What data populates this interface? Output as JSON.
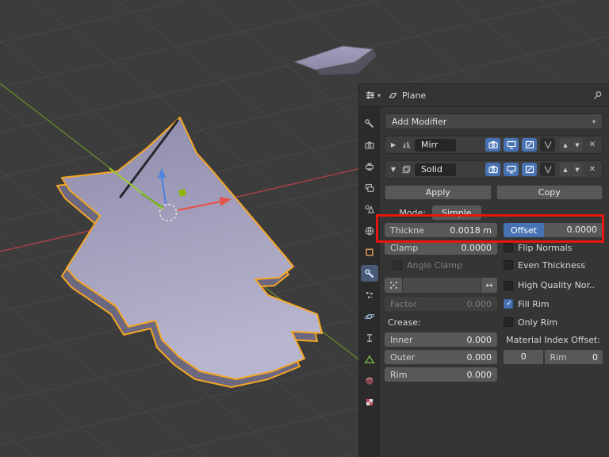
{
  "header": {
    "object_name": "Plane"
  },
  "tabs": {
    "items": [
      "tool",
      "render",
      "output",
      "view-layer",
      "scene",
      "world",
      "object",
      "modifiers",
      "particles",
      "physics",
      "constraints",
      "object-data",
      "material",
      "texture"
    ],
    "active": "modifiers"
  },
  "add_modifier": {
    "label": "Add Modifier"
  },
  "modifier_mirror": {
    "name": "Mirr"
  },
  "modifier_solidify": {
    "name": "Solid"
  },
  "solidify": {
    "apply": "Apply",
    "copy": "Copy",
    "mode_label": "Mode:",
    "mode_value": "Simple",
    "thickness_label": "Thickne",
    "thickness_value": "0.0018 m",
    "offset_label": "Offset",
    "offset_value": "0.0000",
    "clamp_label": "Clamp",
    "clamp_value": "0.0000",
    "angle_clamp": "Angle Clamp",
    "flip_normals": "Flip Normals",
    "even_thickness": "Even Thickness",
    "high_quality": "High Quality Nor..",
    "fill_rim": "Fill Rim",
    "only_rim": "Only Rim",
    "factor_label": "Factor",
    "factor_value": "0.000",
    "crease_label": "Crease:",
    "inner_label": "Inner",
    "inner_value": "0.000",
    "outer_label": "Outer",
    "outer_value": "0.000",
    "rim_label": "Rim",
    "rim_value": "0.000",
    "material_index_label": "Material Index Offset:",
    "mat_offset_value": "0",
    "mat_rim_label": "Rim",
    "mat_rim_value": "0",
    "fill_rim_checked": "true"
  },
  "colors": {
    "highlight_red": "#e8170d",
    "accent_blue": "#4772b3",
    "selection_orange": "#f5a623",
    "axis_x_red": "#c3404f",
    "axis_y_green": "#6a9b27",
    "object_fill": "#a7a4bf"
  }
}
